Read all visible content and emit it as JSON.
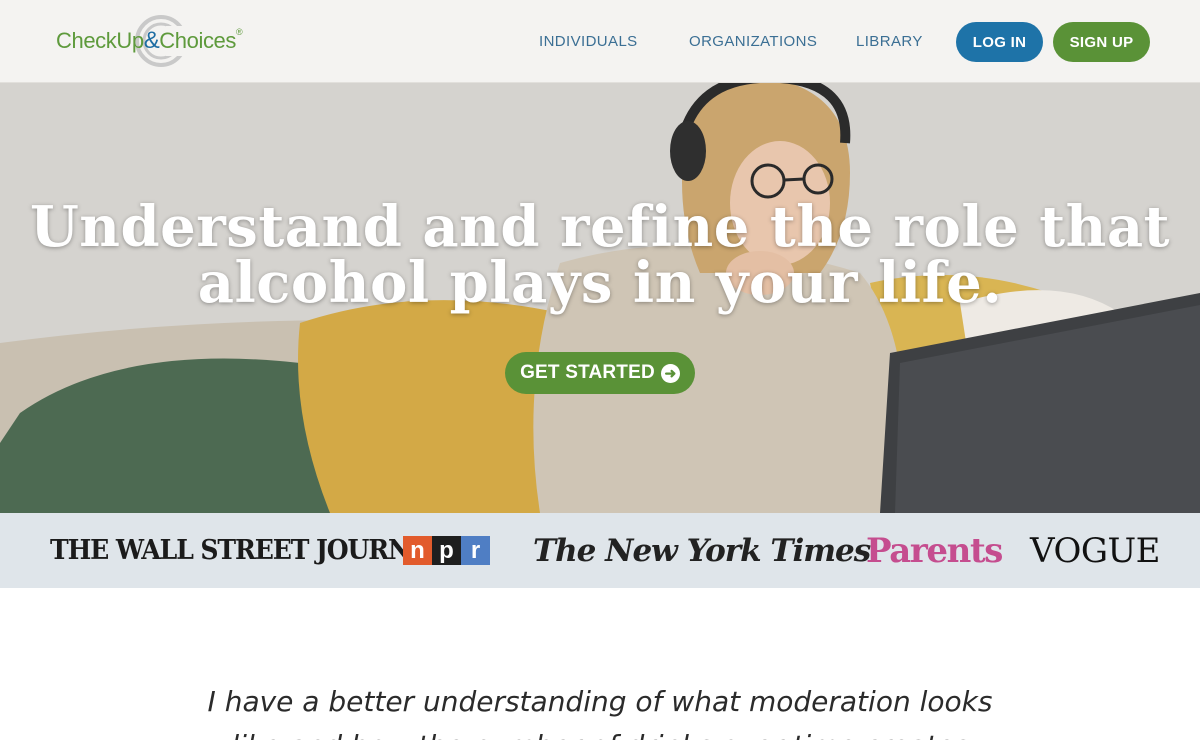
{
  "header": {
    "logo": {
      "text_main": "CheckUp",
      "text_amp": "&",
      "text_end": "Choices",
      "text_tm": "®",
      "brand_green": "#5e9a3c",
      "brand_blue": "#1e6da3"
    },
    "nav": [
      {
        "label": "INDIVIDUALS"
      },
      {
        "label": "ORGANIZATIONS"
      },
      {
        "label": "LIBRARY"
      }
    ],
    "login_label": "LOG IN",
    "signup_label": "SIGN UP"
  },
  "hero": {
    "title_line1": "Understand and refine the role that",
    "title_line2": "alcohol plays in your life.",
    "cta_label": "GET STARTED",
    "cta_icon": "arrow-circle-right-icon"
  },
  "press": {
    "logos": [
      "THE WALL STREET JOURNAL.",
      "npr",
      "The New York Times",
      "Parents",
      "VOGUE"
    ],
    "npr_letters": [
      "n",
      "p",
      "r"
    ]
  },
  "testimonial": {
    "quote": "I have a better understanding of what moderation looks like and how the number of drinks over time creates"
  },
  "colors": {
    "accent_green": "#5a9237",
    "accent_blue": "#1e73a8",
    "nav_text": "#3b6f94",
    "press_bg": "#dfe5ea"
  }
}
